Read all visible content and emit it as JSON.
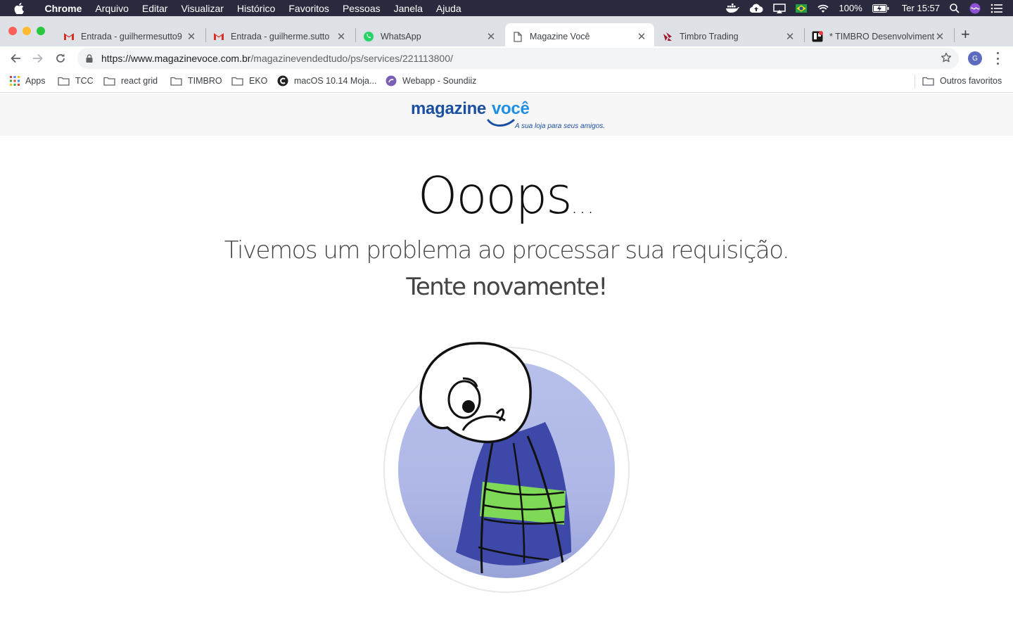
{
  "menubar": {
    "app_name": "Chrome",
    "items": [
      "Arquivo",
      "Editar",
      "Visualizar",
      "Histórico",
      "Favoritos",
      "Pessoas",
      "Janela",
      "Ajuda"
    ],
    "battery": "100%",
    "clock": "Ter 15:57"
  },
  "tabs": [
    {
      "title": "Entrada - guilhermesutto9",
      "icon": "gmail-icon",
      "active": false
    },
    {
      "title": "Entrada - guilherme.sutto",
      "icon": "gmail-icon",
      "active": false
    },
    {
      "title": "WhatsApp",
      "icon": "whatsapp-icon",
      "active": false
    },
    {
      "title": "Magazine Você",
      "icon": "page-icon",
      "active": true
    },
    {
      "title": "Timbro Trading",
      "icon": "timbro-icon",
      "active": false
    },
    {
      "title": "* TIMBRO Desenvolvimento",
      "icon": "trello-icon",
      "active": false
    }
  ],
  "address_bar": {
    "host": "https://www.magazinevoce.com.br",
    "path": "/magazinevendedtudo/ps/services/221113800/"
  },
  "profile_initial": "G",
  "bookmarks": [
    {
      "label": "Apps",
      "icon": "apps-grid-icon"
    },
    {
      "label": "TCC",
      "icon": "folder-icon"
    },
    {
      "label": "react grid",
      "icon": "folder-icon"
    },
    {
      "label": "TIMBRO",
      "icon": "folder-icon"
    },
    {
      "label": "EKO",
      "icon": "folder-icon"
    },
    {
      "label": "macOS 10.14 Moja...",
      "icon": "site-icon"
    },
    {
      "label": "Webapp - Soundiiz",
      "icon": "soundiiz-icon"
    }
  ],
  "other_bookmarks": "Outros favoritos",
  "site": {
    "logo_part1": "magazine",
    "logo_part2": "você",
    "logo_tagline": "A sua loja para seus amigos.",
    "heading": "Ooops",
    "heading_dots": "...",
    "message_line1": "Tivemos um problema ao processar sua requisição.",
    "message_line2": "Tente novamente!"
  },
  "colors": {
    "brand_dark_blue": "#1b4fa1",
    "brand_light_blue": "#1e8fe3",
    "illustration_circle": "#b3bbe8",
    "shirt_blue": "#3d48a8",
    "belt_green": "#7ed957"
  }
}
